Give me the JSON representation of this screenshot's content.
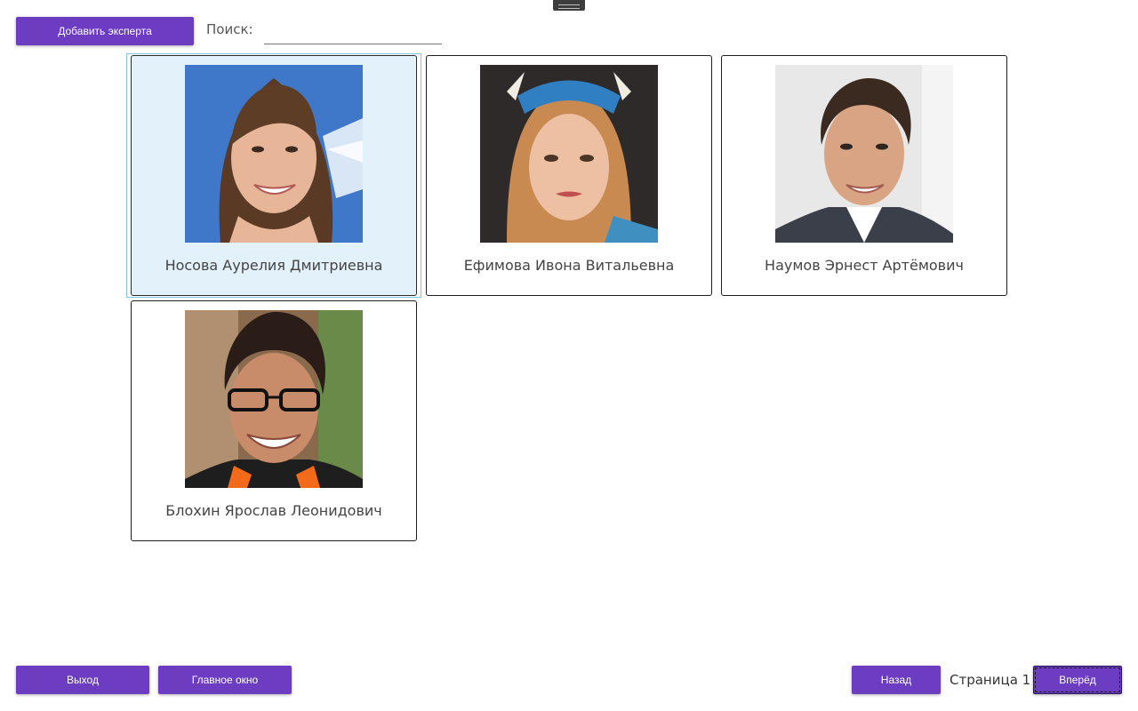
{
  "toolbar": {
    "add_expert_label": "Добавить эксперта",
    "search_label": "Поиск:",
    "search_value": ""
  },
  "experts": [
    {
      "name": "Носова Аурелия Дмитриевна",
      "selected": true
    },
    {
      "name": "Ефимова Ивона Витальевна",
      "selected": false
    },
    {
      "name": "Наумов Эрнест Артёмович",
      "selected": false
    },
    {
      "name": "Блохин Ярослав Леонидович",
      "selected": false
    }
  ],
  "footer": {
    "exit_label": "Выход",
    "main_window_label": "Главное окно",
    "back_label": "Назад",
    "page_label": "Страница 1",
    "forward_label": "Вперёд"
  },
  "colors": {
    "accent": "#6c3cc1",
    "selected_card": "#e3f1fb",
    "background": "#ffffff"
  }
}
